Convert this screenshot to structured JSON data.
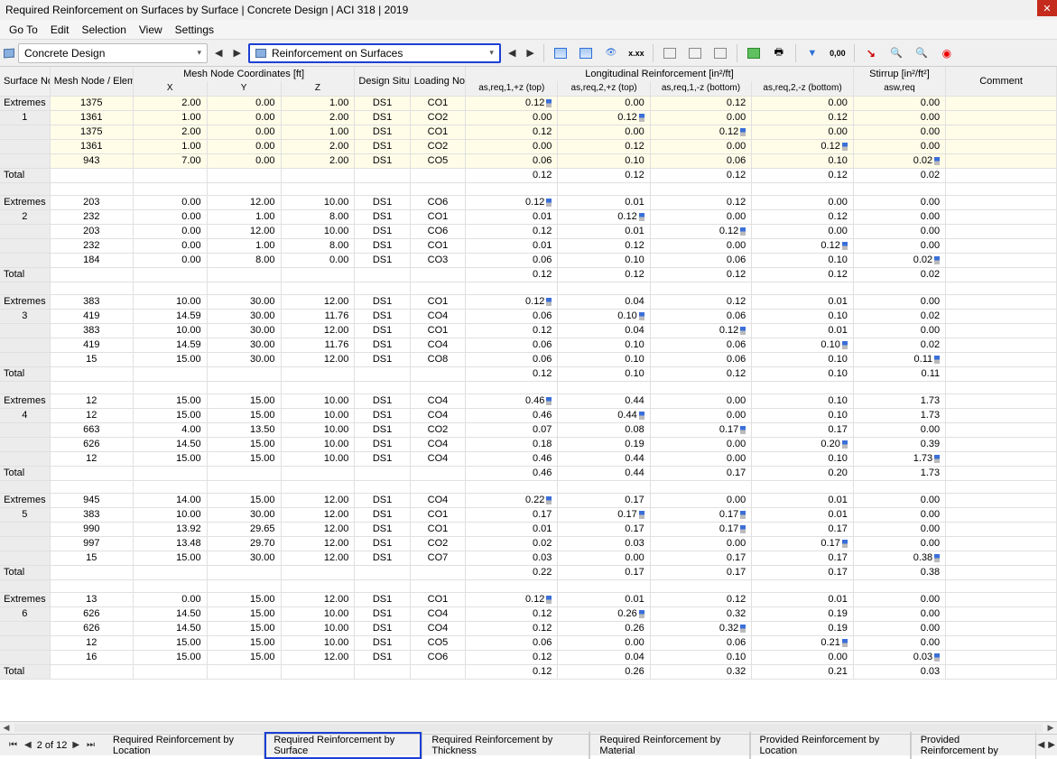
{
  "title": "Required Reinforcement on Surfaces by Surface | Concrete Design | ACI 318 | 2019",
  "menu": [
    "Go To",
    "Edit",
    "Selection",
    "View",
    "Settings"
  ],
  "dropdown1": "Concrete Design",
  "dropdown2": "Reinforcement on Surfaces",
  "columns": {
    "surface_no": "Surface No.",
    "mesh_node": "Mesh Node / Element No.",
    "coord_group": "Mesh Node Coordinates [ft]",
    "x": "X",
    "y": "Y",
    "z": "Z",
    "design_situation": "Design Situation",
    "loading_no": "Loading No.",
    "long_group": "Longitudinal Reinforcement [in²/ft]",
    "a1": "as,req,1,+z (top)",
    "a2": "as,req,2,+z (top)",
    "a3": "as,req,1,-z (bottom)",
    "a4": "as,req,2,-z (bottom)",
    "stirrup_group": "Stirrup [in²/ft²]",
    "asw": "asw,req",
    "comment": "Comment"
  },
  "total_label": "Total",
  "extremes_label": "Extremes",
  "groups": [
    {
      "surface": "1",
      "highlight": true,
      "rows": [
        {
          "n": "1375",
          "x": "2.00",
          "y": "0.00",
          "z": "1.00",
          "ds": "DS1",
          "co": "CO1",
          "a1": "0.12",
          "f1": "b",
          "a2": "0.00",
          "a3": "0.12",
          "a4": "0.00",
          "asw": "0.00"
        },
        {
          "n": "1361",
          "x": "1.00",
          "y": "0.00",
          "z": "2.00",
          "ds": "DS1",
          "co": "CO2",
          "a1": "0.00",
          "a2": "0.12",
          "f2": "b",
          "a3": "0.00",
          "a4": "0.12",
          "asw": "0.00"
        },
        {
          "n": "1375",
          "x": "2.00",
          "y": "0.00",
          "z": "1.00",
          "ds": "DS1",
          "co": "CO1",
          "a1": "0.12",
          "a2": "0.00",
          "a3": "0.12",
          "f3": "b",
          "a4": "0.00",
          "asw": "0.00"
        },
        {
          "n": "1361",
          "x": "1.00",
          "y": "0.00",
          "z": "2.00",
          "ds": "DS1",
          "co": "CO2",
          "a1": "0.00",
          "a2": "0.12",
          "a3": "0.00",
          "a4": "0.12",
          "f4": "b",
          "asw": "0.00"
        },
        {
          "n": "943",
          "x": "7.00",
          "y": "0.00",
          "z": "2.00",
          "ds": "DS1",
          "co": "CO5",
          "a1": "0.06",
          "a2": "0.10",
          "a3": "0.06",
          "a4": "0.10",
          "asw": "0.02",
          "fs": "b"
        }
      ],
      "total": {
        "a1": "0.12",
        "a2": "0.12",
        "a3": "0.12",
        "a4": "0.12",
        "asw": "0.02"
      }
    },
    {
      "surface": "2",
      "rows": [
        {
          "n": "203",
          "x": "0.00",
          "y": "12.00",
          "z": "10.00",
          "ds": "DS1",
          "co": "CO6",
          "a1": "0.12",
          "f1": "b",
          "a2": "0.01",
          "a3": "0.12",
          "a4": "0.00",
          "asw": "0.00"
        },
        {
          "n": "232",
          "x": "0.00",
          "y": "1.00",
          "z": "8.00",
          "ds": "DS1",
          "co": "CO1",
          "a1": "0.01",
          "a2": "0.12",
          "f2": "b",
          "a3": "0.00",
          "a4": "0.12",
          "asw": "0.00"
        },
        {
          "n": "203",
          "x": "0.00",
          "y": "12.00",
          "z": "10.00",
          "ds": "DS1",
          "co": "CO6",
          "a1": "0.12",
          "a2": "0.01",
          "a3": "0.12",
          "f3": "b",
          "a4": "0.00",
          "asw": "0.00"
        },
        {
          "n": "232",
          "x": "0.00",
          "y": "1.00",
          "z": "8.00",
          "ds": "DS1",
          "co": "CO1",
          "a1": "0.01",
          "a2": "0.12",
          "a3": "0.00",
          "a4": "0.12",
          "f4": "b",
          "asw": "0.00"
        },
        {
          "n": "184",
          "x": "0.00",
          "y": "8.00",
          "z": "0.00",
          "ds": "DS1",
          "co": "CO3",
          "a1": "0.06",
          "a2": "0.10",
          "a3": "0.06",
          "a4": "0.10",
          "asw": "0.02",
          "fs": "b"
        }
      ],
      "total": {
        "a1": "0.12",
        "a2": "0.12",
        "a3": "0.12",
        "a4": "0.12",
        "asw": "0.02"
      }
    },
    {
      "surface": "3",
      "rows": [
        {
          "n": "383",
          "x": "10.00",
          "y": "30.00",
          "z": "12.00",
          "ds": "DS1",
          "co": "CO1",
          "a1": "0.12",
          "f1": "b",
          "a2": "0.04",
          "a3": "0.12",
          "a4": "0.01",
          "asw": "0.00"
        },
        {
          "n": "419",
          "x": "14.59",
          "y": "30.00",
          "z": "11.76",
          "ds": "DS1",
          "co": "CO4",
          "a1": "0.06",
          "a2": "0.10",
          "f2": "b",
          "a3": "0.06",
          "a4": "0.10",
          "asw": "0.02"
        },
        {
          "n": "383",
          "x": "10.00",
          "y": "30.00",
          "z": "12.00",
          "ds": "DS1",
          "co": "CO1",
          "a1": "0.12",
          "a2": "0.04",
          "a3": "0.12",
          "f3": "b",
          "a4": "0.01",
          "asw": "0.00"
        },
        {
          "n": "419",
          "x": "14.59",
          "y": "30.00",
          "z": "11.76",
          "ds": "DS1",
          "co": "CO4",
          "a1": "0.06",
          "a2": "0.10",
          "a3": "0.06",
          "a4": "0.10",
          "f4": "b",
          "asw": "0.02"
        },
        {
          "n": "15",
          "x": "15.00",
          "y": "30.00",
          "z": "12.00",
          "ds": "DS1",
          "co": "CO8",
          "a1": "0.06",
          "a2": "0.10",
          "a3": "0.06",
          "a4": "0.10",
          "asw": "0.11",
          "fs": "b"
        }
      ],
      "total": {
        "a1": "0.12",
        "a2": "0.10",
        "a3": "0.12",
        "a4": "0.10",
        "asw": "0.11"
      }
    },
    {
      "surface": "4",
      "rows": [
        {
          "n": "12",
          "x": "15.00",
          "y": "15.00",
          "z": "10.00",
          "ds": "DS1",
          "co": "CO4",
          "a1": "0.46",
          "f1": "b",
          "a2": "0.44",
          "a3": "0.00",
          "a4": "0.10",
          "asw": "1.73"
        },
        {
          "n": "12",
          "x": "15.00",
          "y": "15.00",
          "z": "10.00",
          "ds": "DS1",
          "co": "CO4",
          "a1": "0.46",
          "a2": "0.44",
          "f2": "b",
          "a3": "0.00",
          "a4": "0.10",
          "asw": "1.73"
        },
        {
          "n": "663",
          "x": "4.00",
          "y": "13.50",
          "z": "10.00",
          "ds": "DS1",
          "co": "CO2",
          "a1": "0.07",
          "a2": "0.08",
          "a3": "0.17",
          "f3": "b",
          "a4": "0.17",
          "asw": "0.00"
        },
        {
          "n": "626",
          "x": "14.50",
          "y": "15.00",
          "z": "10.00",
          "ds": "DS1",
          "co": "CO4",
          "a1": "0.18",
          "a2": "0.19",
          "a3": "0.00",
          "a4": "0.20",
          "f4": "b",
          "asw": "0.39"
        },
        {
          "n": "12",
          "x": "15.00",
          "y": "15.00",
          "z": "10.00",
          "ds": "DS1",
          "co": "CO4",
          "a1": "0.46",
          "a2": "0.44",
          "a3": "0.00",
          "a4": "0.10",
          "asw": "1.73",
          "fs": "b"
        }
      ],
      "total": {
        "a1": "0.46",
        "a2": "0.44",
        "a3": "0.17",
        "a4": "0.20",
        "asw": "1.73"
      }
    },
    {
      "surface": "5",
      "rows": [
        {
          "n": "945",
          "x": "14.00",
          "y": "15.00",
          "z": "12.00",
          "ds": "DS1",
          "co": "CO4",
          "a1": "0.22",
          "f1": "b",
          "a2": "0.17",
          "a3": "0.00",
          "a4": "0.01",
          "asw": "0.00"
        },
        {
          "n": "383",
          "x": "10.00",
          "y": "30.00",
          "z": "12.00",
          "ds": "DS1",
          "co": "CO1",
          "a1": "0.17",
          "a2": "0.17",
          "f2": "b",
          "a3": "0.17",
          "f3": "b",
          "a4": "0.01",
          "asw": "0.00"
        },
        {
          "n": "990",
          "x": "13.92",
          "y": "29.65",
          "z": "12.00",
          "ds": "DS1",
          "co": "CO1",
          "a1": "0.01",
          "a2": "0.17",
          "a3": "0.17",
          "f3": "b",
          "a4": "0.17",
          "asw": "0.00"
        },
        {
          "n": "997",
          "x": "13.48",
          "y": "29.70",
          "z": "12.00",
          "ds": "DS1",
          "co": "CO2",
          "a1": "0.02",
          "a2": "0.03",
          "a3": "0.00",
          "a4": "0.17",
          "f4": "b",
          "asw": "0.00"
        },
        {
          "n": "15",
          "x": "15.00",
          "y": "30.00",
          "z": "12.00",
          "ds": "DS1",
          "co": "CO7",
          "a1": "0.03",
          "a2": "0.00",
          "a3": "0.17",
          "a4": "0.17",
          "asw": "0.38",
          "fs": "b"
        }
      ],
      "total": {
        "a1": "0.22",
        "a2": "0.17",
        "a3": "0.17",
        "a4": "0.17",
        "asw": "0.38"
      }
    },
    {
      "surface": "6",
      "rows": [
        {
          "n": "13",
          "x": "0.00",
          "y": "15.00",
          "z": "12.00",
          "ds": "DS1",
          "co": "CO1",
          "a1": "0.12",
          "f1": "b",
          "a2": "0.01",
          "a3": "0.12",
          "a4": "0.01",
          "asw": "0.00"
        },
        {
          "n": "626",
          "x": "14.50",
          "y": "15.00",
          "z": "10.00",
          "ds": "DS1",
          "co": "CO4",
          "a1": "0.12",
          "a2": "0.26",
          "f2": "b",
          "a3": "0.32",
          "a4": "0.19",
          "asw": "0.00"
        },
        {
          "n": "626",
          "x": "14.50",
          "y": "15.00",
          "z": "10.00",
          "ds": "DS1",
          "co": "CO4",
          "a1": "0.12",
          "a2": "0.26",
          "a3": "0.32",
          "f3": "b",
          "a4": "0.19",
          "asw": "0.00"
        },
        {
          "n": "12",
          "x": "15.00",
          "y": "15.00",
          "z": "10.00",
          "ds": "DS1",
          "co": "CO5",
          "a1": "0.06",
          "a2": "0.00",
          "a3": "0.06",
          "a4": "0.21",
          "f4": "b",
          "asw": "0.00"
        },
        {
          "n": "16",
          "x": "15.00",
          "y": "15.00",
          "z": "12.00",
          "ds": "DS1",
          "co": "CO6",
          "a1": "0.12",
          "a2": "0.04",
          "a3": "0.10",
          "a4": "0.00",
          "asw": "0.03",
          "fs": "b"
        }
      ],
      "total": {
        "a1": "0.12",
        "a2": "0.26",
        "a3": "0.32",
        "a4": "0.21",
        "asw": "0.03"
      }
    }
  ],
  "page_info": "2 of 12",
  "tabs": [
    "Required Reinforcement by Location",
    "Required Reinforcement by Surface",
    "Required Reinforcement by Thickness",
    "Required Reinforcement by Material",
    "Provided Reinforcement by Location",
    "Provided Reinforcement by"
  ],
  "active_tab": 1
}
